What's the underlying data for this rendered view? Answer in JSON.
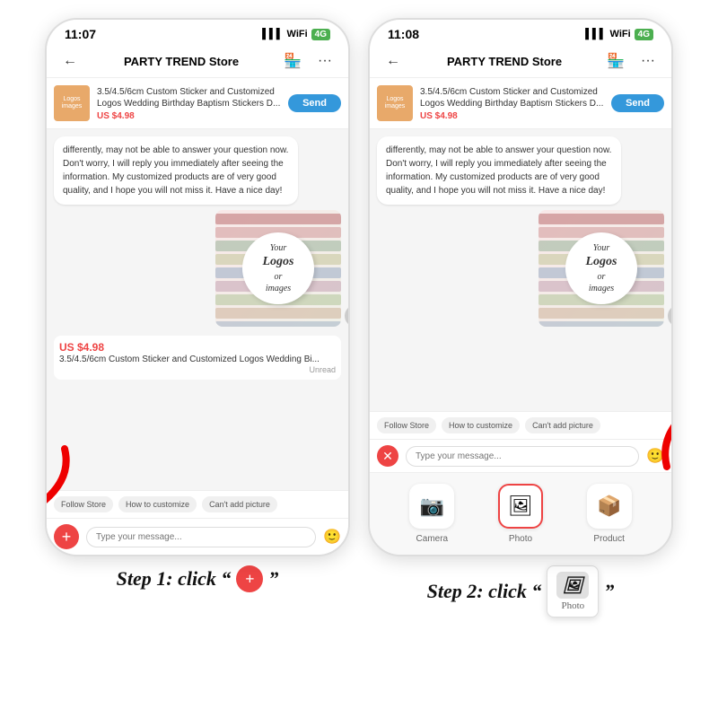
{
  "phone1": {
    "time": "11:07",
    "store_name": "PARTY TREND Store",
    "product_title": "3.5/4.5/6cm Custom Sticker and Customized Logos Wedding Birthday Baptism Stickers D...",
    "product_price": "US $4.98",
    "send_label": "Send",
    "message_text": "differently, may not be able to answer your question now. Don't worry, I will reply you immediately after seeing the information. My customized products are of very good quality, and I hope you will not miss it. Have a nice day!",
    "sticker_text_line1": "Your",
    "sticker_text_line2": "Logos",
    "sticker_text_line3": "or",
    "sticker_text_line4": "images",
    "bottom_price": "US $4.98",
    "bottom_title": "3.5/4.5/6cm Custom Sticker and Customized Logos Wedding Bi...",
    "unread": "Unread",
    "quick_replies": [
      "Follow Store",
      "How to customize",
      "Can't add picture"
    ],
    "input_placeholder": "Type your message...",
    "add_icon": "+",
    "emoji_icon": "🙂"
  },
  "phone2": {
    "time": "11:08",
    "store_name": "PARTY TREND Store",
    "product_title": "3.5/4.5/6cm Custom Sticker and Customized Logos Wedding Birthday Baptism Stickers D...",
    "product_price": "US $4.98",
    "send_label": "Send",
    "message_text": "differently, may not be able to answer your question now. Don't worry, I will reply you immediately after seeing the information. My customized products are of very good quality, and I hope you will not miss it. Have a nice day!",
    "sticker_text_line1": "Your",
    "sticker_text_line2": "Logos",
    "sticker_text_line3": "or",
    "sticker_text_line4": "images",
    "quick_replies": [
      "Follow Store",
      "How to customize",
      "Can't add picture"
    ],
    "input_placeholder": "Type your message...",
    "emoji_icon": "🙂",
    "media_items": [
      {
        "label": "Camera",
        "icon": "📷"
      },
      {
        "label": "Photo",
        "icon": "🖼"
      },
      {
        "label": "Product",
        "icon": "📦"
      }
    ]
  },
  "step1": {
    "label": "Step 1: click “",
    "label_end": "”",
    "icon": "+"
  },
  "step2": {
    "label": "Step 2: click “",
    "label_end": "”",
    "photo_label": "Photo"
  }
}
